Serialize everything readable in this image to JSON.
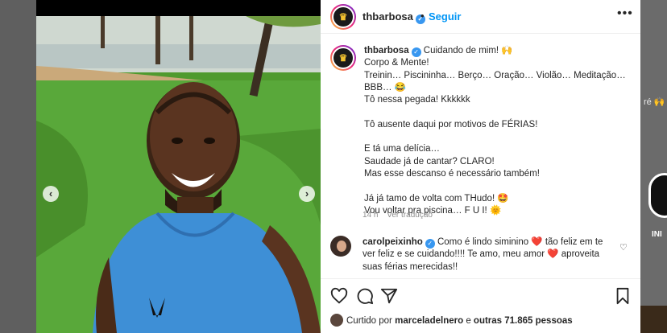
{
  "post": {
    "author": "thbarbosa",
    "follow_label": "Seguir",
    "separator": "•",
    "more_icon": "•••",
    "avatar_logo": "♛"
  },
  "caption": {
    "author": "thbarbosa",
    "lines": [
      "Cuidando de mim! 🙌",
      "Corpo & Mente!",
      "Treinin… Piscininha… Berço… Oração… Violão… Meditação…",
      "BBB… 😂",
      "Tô nessa pegada! Kkkkkk",
      "",
      "Tô ausente daqui por motivos de FÉRIAS!",
      "",
      "E tá uma delícia…",
      "Saudade já de cantar? CLARO!",
      "Mas esse descanso é necessário também!",
      "",
      "Já já tamo de volta com THudo! 🤩",
      "Vou voltar pra piscina… F U I! 🌞"
    ],
    "time": "14 h",
    "translate_label": "Ver tradução"
  },
  "comment": {
    "author": "carolpeixinho",
    "text": "Como é lindo siminino ❤️ tão feliz em te ver feliz e se cuidando!!!! Te amo, meu amor ❤️ aproveita suas férias merecidas!!",
    "like_icon": "♡"
  },
  "likes": {
    "prefix": "Curtido por",
    "user": "marceladelnero",
    "connector": "e",
    "others": "outras 71.865 pessoas"
  },
  "photo": {
    "prev_icon": "‹",
    "next_icon": "›"
  },
  "background": {
    "ghost_text": "ré 🙌",
    "ghost_label": "INI"
  },
  "colors": {
    "accent": "#0095f6",
    "verified": "#3897f0",
    "text": "#262626",
    "muted": "#8e8e8e"
  }
}
